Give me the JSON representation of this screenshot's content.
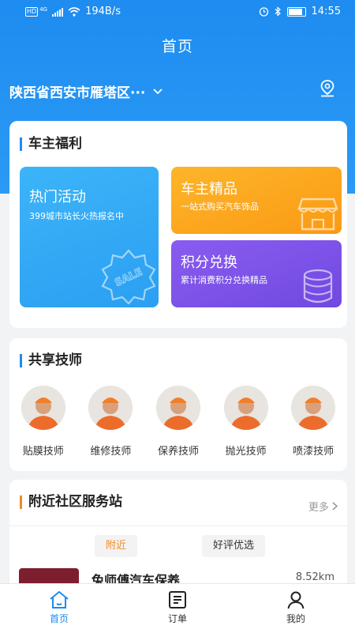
{
  "status": {
    "network_speed": "194B/s",
    "hd_badge": "HD",
    "signal_label": "4G",
    "time": "14:55"
  },
  "header": {
    "title": "首页",
    "location": "陕西省西安市雁塔区···"
  },
  "benefits": {
    "title": "车主福利",
    "hot": {
      "title": "热门活动",
      "subtitle": "399城市站长火热报名中",
      "badge_text": "SALE"
    },
    "boutique": {
      "title": "车主精品",
      "subtitle": "一站式购买汽车饰品"
    },
    "points": {
      "title": "积分兑换",
      "subtitle": "累计消费积分兑换精品"
    }
  },
  "technicians": {
    "title": "共享技师",
    "items": [
      {
        "label": "贴膜技师"
      },
      {
        "label": "维修技师"
      },
      {
        "label": "保养技师"
      },
      {
        "label": "抛光技师"
      },
      {
        "label": "喷漆技师"
      }
    ]
  },
  "stations": {
    "title": "附近社区服务站",
    "more_label": "更多",
    "filters": [
      "附近",
      "好评优选"
    ],
    "first_item": {
      "name": "兔师傅汽车保养",
      "distance": "8.52km"
    }
  },
  "bottom_nav": {
    "items": [
      {
        "label": "首页",
        "icon": "home-icon"
      },
      {
        "label": "订单",
        "icon": "order-icon"
      },
      {
        "label": "我的",
        "icon": "profile-icon"
      }
    ]
  },
  "colors": {
    "primary": "#1e8cf0",
    "accent_orange": "#f08a24",
    "hot_tile": "#38b0f6",
    "boutique_tile": "#fba41c",
    "points_tile": "#7d54e6"
  }
}
